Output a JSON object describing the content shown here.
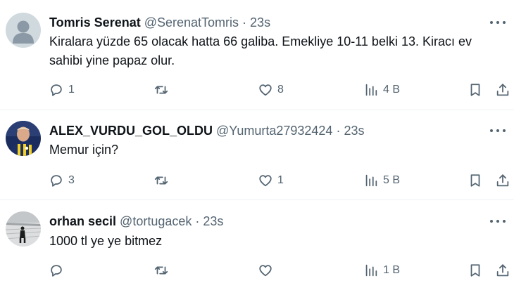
{
  "tweets": [
    {
      "name": "Tomris Serenat",
      "handle": "@SerenatTomris",
      "separator": "·",
      "time": "23s",
      "text": "Kiralara yüzde 65 olacak hatta 66 galiba. Emekliye 10-11 belki 13. Kiracı ev sahibi yine papaz olur.",
      "replies": "1",
      "retweets": "",
      "likes": "8",
      "views": "4 B",
      "avatar": "default-person-icon"
    },
    {
      "name": "ALEX_VURDU_GOL_OLDU",
      "handle": "@Yumurta27932424",
      "separator": "·",
      "time": "23s",
      "text": "Memur için?",
      "replies": "3",
      "retweets": "",
      "likes": "1",
      "views": "5 B",
      "avatar": "football-player-photo"
    },
    {
      "name": "orhan secil",
      "handle": "@tortugacek",
      "separator": "·",
      "time": "23s",
      "text": "1000 tl ye ye bitmez",
      "replies": "",
      "retweets": "",
      "likes": "",
      "views": "1 B",
      "avatar": "person-in-snow-photo"
    }
  ],
  "colors": {
    "text": "#0f1419",
    "secondary": "#536471",
    "divider": "#eff3f4"
  }
}
